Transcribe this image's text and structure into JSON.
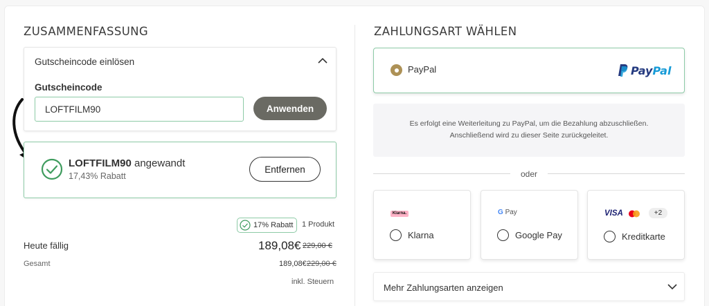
{
  "summary": {
    "title": "ZUSAMMENFASSUNG",
    "voucher_toggle_label": "Gutscheincode einlösen",
    "voucher_field_label": "Gutscheincode",
    "voucher_value": "LOFTFILM90",
    "apply_label": "Anwenden",
    "applied_code": "LOFTFILM90",
    "applied_suffix": " angewandt",
    "applied_discount": "17,43% Rabatt",
    "remove_label": "Entfernen",
    "discount_badge": "17% Rabatt",
    "product_count": "1 Produkt",
    "due_today_label": "Heute fällig",
    "due_today_price": "189,08€",
    "due_today_old_price": "229,00 €",
    "total_label": "Gesamt",
    "total_price": "189,08€",
    "total_old_price": "229,00 €",
    "tax_note": "inkl. Steuern"
  },
  "payment": {
    "title": "ZAHLUNGSART WÄHLEN",
    "paypal_label": "PayPal",
    "paypal_logo_part1": "Pay",
    "paypal_logo_part2": "Pal",
    "redirect_line1": "Es erfolgt eine Weiterleitung zu PayPal, um die Bezahlung abzuschließen.",
    "redirect_line2": "Anschließend wird zu dieser Seite zurückgeleitet.",
    "or_label": "oder",
    "klarna_logo_text": "Klarna.",
    "klarna_label": "Klarna",
    "gpay_logo_text": "Pay",
    "gpay_g": "G",
    "gpay_label": "Google Pay",
    "visa_logo_text": "VISA",
    "more_cards_badge": "+2",
    "card_label": "Kreditkarte",
    "more_methods_label": "Mehr Zahlungsarten anzeigen"
  },
  "colors": {
    "accent_green": "#8ccaa6",
    "check_green": "#3f9c5e",
    "apply_button": "#6a6a63",
    "radio_selected": "#ad9156",
    "paypal_dark": "#253b80",
    "paypal_light": "#179bd7",
    "klarna_pink": "#ffb3c7"
  },
  "icons": {
    "chevron_up": "chevron-up-icon",
    "check_circle": "check-circle-icon",
    "chevron_down": "chevron-down-icon",
    "mastercard": "mastercard-icon",
    "arrow": "curved-arrow-icon"
  }
}
